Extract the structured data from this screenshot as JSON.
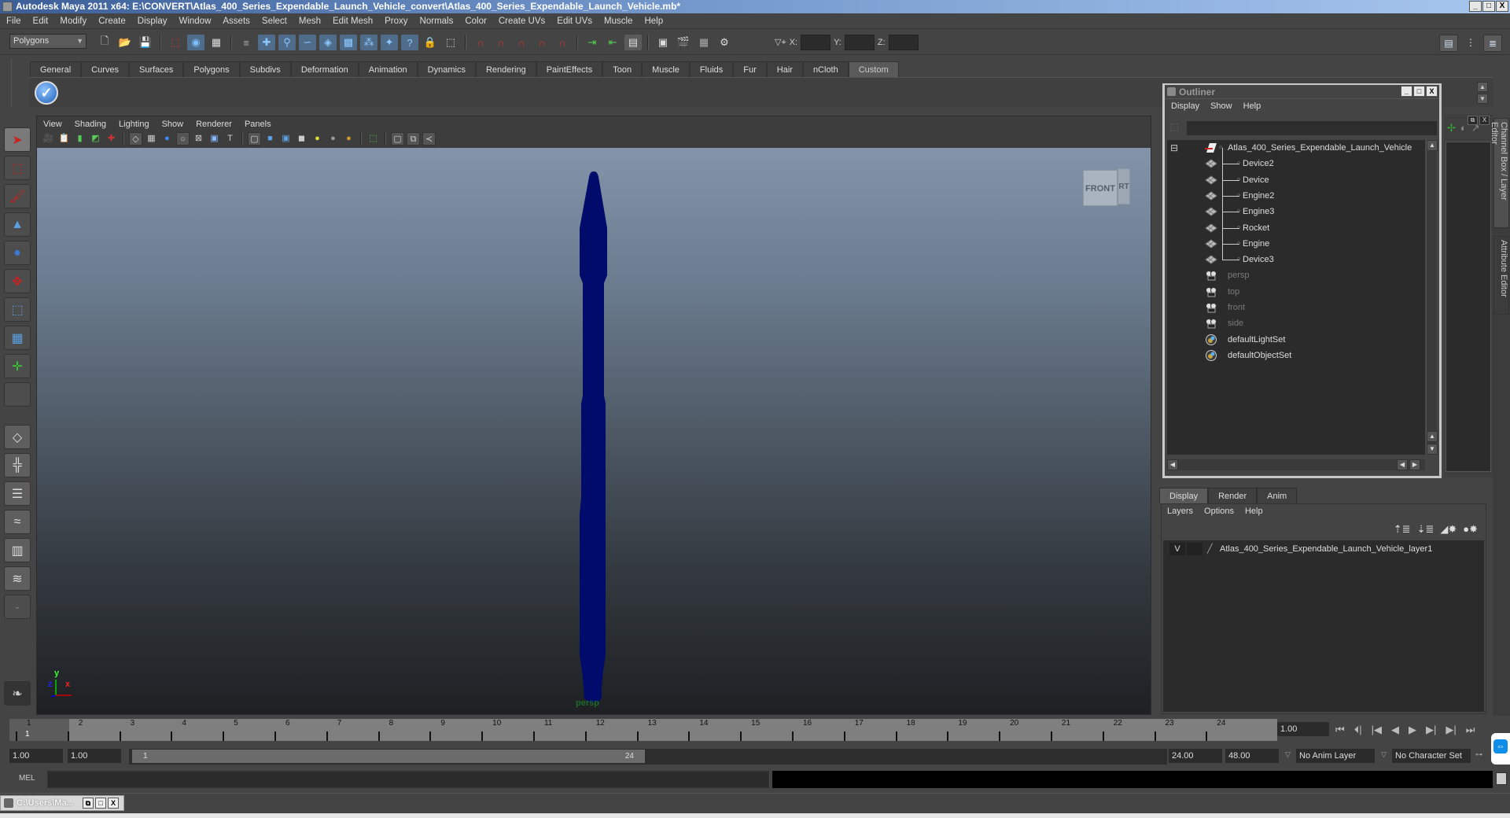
{
  "window": {
    "title": "Autodesk Maya 2011 x64: E:\\CONVERT\\Atlas_400_Series_Expendable_Launch_Vehicle_convert\\Atlas_400_Series_Expendable_Launch_Vehicle.mb*",
    "minimize": "_",
    "maximize": "□",
    "close": "X"
  },
  "menubar": [
    "File",
    "Edit",
    "Modify",
    "Create",
    "Display",
    "Window",
    "Assets",
    "Select",
    "Mesh",
    "Edit Mesh",
    "Proxy",
    "Normals",
    "Color",
    "Create UVs",
    "Edit UVs",
    "Muscle",
    "Help"
  ],
  "statusline": {
    "mode": "Polygons",
    "x_label": "X:",
    "y_label": "Y:",
    "z_label": "Z:",
    "x_value": "",
    "y_value": "",
    "z_value": ""
  },
  "shelf": {
    "tabs": [
      "General",
      "Curves",
      "Surfaces",
      "Polygons",
      "Subdivs",
      "Deformation",
      "Animation",
      "Dynamics",
      "Rendering",
      "PaintEffects",
      "Toon",
      "Muscle",
      "Fluids",
      "Fur",
      "Hair",
      "nCloth",
      "Custom"
    ],
    "active_tab": "Custom"
  },
  "viewport": {
    "menu": [
      "View",
      "Shading",
      "Lighting",
      "Show",
      "Renderer",
      "Panels"
    ],
    "camera_label": "persp",
    "viewcube_front": "FRONT",
    "viewcube_side": "RT",
    "axis": {
      "x": "x",
      "y": "y",
      "z": "z"
    },
    "object_color": "#000b6b"
  },
  "outliner": {
    "title": "Outliner",
    "menu": [
      "Display",
      "Show",
      "Help"
    ],
    "filter_value": "",
    "items": [
      {
        "label": "Atlas_400_Series_Expendable_Launch_Vehicle",
        "type": "group",
        "dim": false
      },
      {
        "label": "Device2",
        "type": "mesh",
        "dim": false
      },
      {
        "label": "Device",
        "type": "mesh",
        "dim": false
      },
      {
        "label": "Engine2",
        "type": "mesh",
        "dim": false
      },
      {
        "label": "Engine3",
        "type": "mesh",
        "dim": false
      },
      {
        "label": "Rocket",
        "type": "mesh",
        "dim": false
      },
      {
        "label": "Engine",
        "type": "mesh",
        "dim": false
      },
      {
        "label": "Device3",
        "type": "mesh",
        "dim": false
      },
      {
        "label": "persp",
        "type": "camera",
        "dim": true
      },
      {
        "label": "top",
        "type": "camera",
        "dim": true
      },
      {
        "label": "front",
        "type": "camera",
        "dim": true
      },
      {
        "label": "side",
        "type": "camera",
        "dim": true
      },
      {
        "label": "defaultLightSet",
        "type": "set",
        "dim": false
      },
      {
        "label": "defaultObjectSet",
        "type": "set",
        "dim": false
      }
    ]
  },
  "side_tabs": [
    "Channel Box / Layer Editor",
    "Attribute Editor"
  ],
  "layer_editor": {
    "tabs": [
      "Display",
      "Render",
      "Anim"
    ],
    "active_tab": "Display",
    "menu": [
      "Layers",
      "Options",
      "Help"
    ],
    "layers": [
      {
        "visible": "V",
        "name": "Atlas_400_Series_Expendable_Launch_Vehicle_layer1"
      }
    ]
  },
  "timeline": {
    "ticks": [
      "1",
      "2",
      "3",
      "4",
      "5",
      "6",
      "7",
      "8",
      "9",
      "10",
      "11",
      "12",
      "13",
      "14",
      "15",
      "16",
      "17",
      "18",
      "19",
      "20",
      "21",
      "22",
      "23",
      "24"
    ],
    "current_marker": "1",
    "current_frame": "1.00"
  },
  "range": {
    "start_time": "1.00",
    "playback_start": "1.00",
    "range_start": "1",
    "range_end": "24",
    "playback_end": "24.00",
    "end_time": "48.00",
    "anim_layer": "No Anim Layer",
    "character_set": "No Character Set"
  },
  "cmdline": {
    "label": "MEL",
    "value": ""
  },
  "taskbar": {
    "label": "C:\\Users\\Ma..."
  }
}
